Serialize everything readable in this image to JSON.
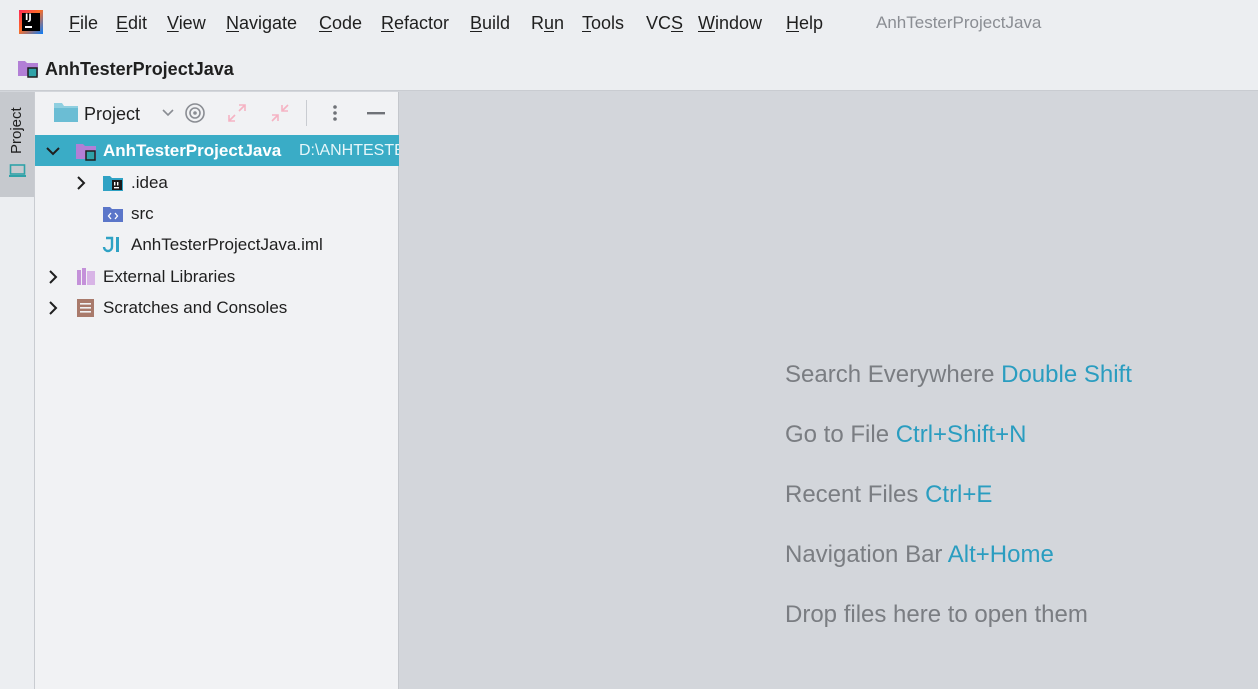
{
  "menu": {
    "items": [
      {
        "id": "file",
        "mnemonic": "F",
        "rest": "ile"
      },
      {
        "id": "edit",
        "mnemonic": "E",
        "rest": "dit"
      },
      {
        "id": "view",
        "mnemonic": "V",
        "rest": "iew"
      },
      {
        "id": "navigate",
        "mnemonic": "N",
        "rest": "avigate"
      },
      {
        "id": "code",
        "mnemonic": "C",
        "rest": "ode"
      },
      {
        "id": "refactor",
        "mnemonic": "R",
        "rest": "efactor"
      },
      {
        "id": "build",
        "mnemonic": "B",
        "rest": "uild"
      },
      {
        "id": "run",
        "pre": "R",
        "mnemonic": "u",
        "rest": "n"
      },
      {
        "id": "tools",
        "mnemonic": "T",
        "rest": "ools"
      },
      {
        "id": "vcs",
        "pre": "VC",
        "mnemonic": "S",
        "rest": ""
      },
      {
        "id": "window",
        "mnemonic": "W",
        "rest": "indow"
      },
      {
        "id": "help",
        "mnemonic": "H",
        "rest": "elp"
      }
    ],
    "window_title": "AnhTesterProjectJava"
  },
  "navbar": {
    "project_name": "AnhTesterProjectJava"
  },
  "toolstrip": {
    "project_tab": "Project"
  },
  "project_panel": {
    "view_selector": "Project",
    "tree": {
      "root": {
        "label": "AnhTesterProjectJava",
        "path": "D:\\ANHTESTER\\..."
      },
      "children": [
        {
          "label": ".idea"
        },
        {
          "label": "src"
        },
        {
          "label": "AnhTesterProjectJava.iml"
        }
      ],
      "external_libraries": "External Libraries",
      "scratches": "Scratches and Consoles"
    }
  },
  "editor": {
    "hints": [
      {
        "text": "Search Everywhere",
        "shortcut": "Double Shift"
      },
      {
        "text": "Go to File",
        "shortcut": "Ctrl+Shift+N"
      },
      {
        "text": "Recent Files",
        "shortcut": "Ctrl+E"
      },
      {
        "text": "Navigation Bar",
        "shortcut": "Alt+Home"
      },
      {
        "text": "Drop files here to open them",
        "shortcut": ""
      }
    ]
  },
  "colors": {
    "selection": "#3aacc6",
    "shortcut": "#2a9dc0",
    "module_folder": "#b27fd6"
  }
}
